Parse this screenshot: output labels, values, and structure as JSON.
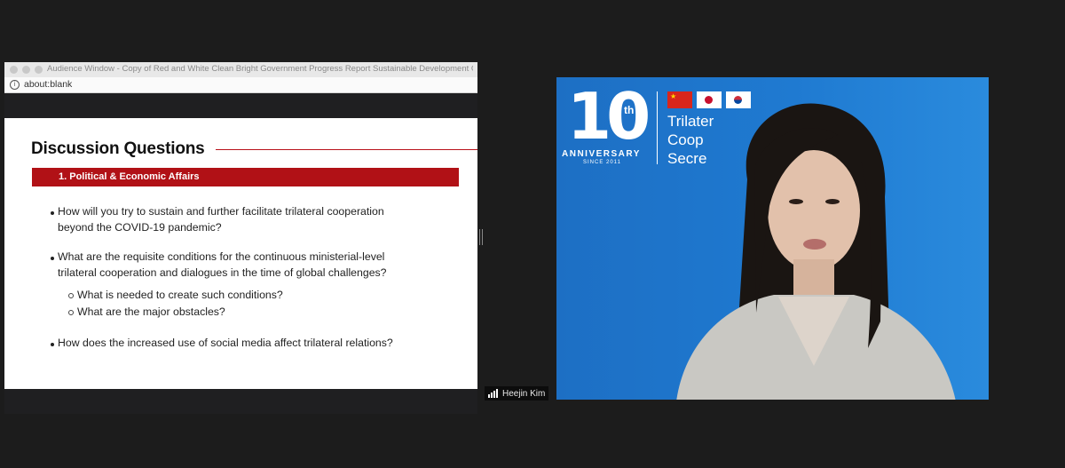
{
  "shared_window": {
    "title": "Audience Window - Copy of Red and White Clean Bright Government Progress Report Sustainable Development Goa...",
    "url": "about:blank",
    "url_icon": "info-icon"
  },
  "slide": {
    "title": "Discussion Questions",
    "section": "1. Political & Economic Affairs",
    "questions": [
      {
        "lines": [
          "How will you try to sustain and further facilitate trilateral cooperation",
          "beyond the COVID-19 pandemic?"
        ]
      },
      {
        "lines": [
          "What are the requisite conditions for the continuous ministerial-level",
          "trilateral cooperation and dialogues in the time of global challenges?"
        ]
      },
      {
        "lines": [
          "How does the increased use of social media affect trilateral relations?"
        ]
      }
    ],
    "sub_questions": [
      "What is needed to create such conditions?",
      "What are the major obstacles?"
    ]
  },
  "participant": {
    "name": "Heejin Kim",
    "signal_icon": "signal-bars-icon"
  },
  "video_background": {
    "logo_number": "10",
    "logo_suffix": "th",
    "logo_anniversary": "ANNIVERSARY",
    "logo_since": "SINCE 2011",
    "org_lines": [
      "Trilater",
      "Coop",
      "Secre"
    ],
    "colors": {
      "accent_red": "#b11116",
      "video_blue": "#1f7ad1"
    }
  }
}
